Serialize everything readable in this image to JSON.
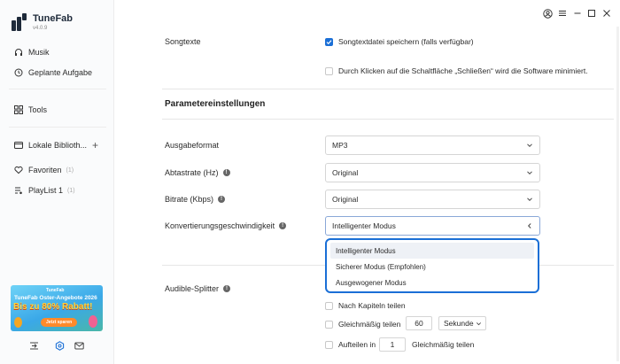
{
  "app": {
    "name": "TuneFab",
    "version": "v4.0.9"
  },
  "sidebar": {
    "items": [
      {
        "label": "Musik",
        "icon": "headphones-icon"
      },
      {
        "label": "Geplante Aufgabe",
        "icon": "clock-icon"
      },
      {
        "label": "Tools",
        "icon": "grid-icon"
      },
      {
        "label": "Lokale Biblioth...",
        "icon": "folder-icon"
      },
      {
        "label": "Favoriten",
        "count": "(1)",
        "icon": "heart-icon"
      },
      {
        "label": "PlayList 1",
        "count": "(1)",
        "icon": "playlist-icon"
      }
    ],
    "add_symbol": "+",
    "promo": {
      "brand": "TuneFab",
      "title": "TuneFab Oster-Angebote 2026",
      "headline": "Bis zu 80% Rabatt!",
      "button": "Jetzt sparen"
    }
  },
  "settings": {
    "songtexte": {
      "label": "Songtexte",
      "save_lyrics": "Songtextdatei speichern (falls verfügbar)",
      "save_lyrics_checked": true,
      "minimize_on_close": "Durch Klicken auf die Schaltfläche „Schließen“ wird die Software minimiert.",
      "minimize_on_close_checked": false
    },
    "section_title": "Parametereinstellungen",
    "output_format": {
      "label": "Ausgabeformat",
      "value": "MP3"
    },
    "sample_rate": {
      "label": "Abtastrate (Hz)",
      "value": "Original"
    },
    "bitrate": {
      "label": "Bitrate (Kbps)",
      "value": "Original"
    },
    "conversion_speed": {
      "label": "Konvertierungsgeschwindigkeit",
      "value": "Intelligenter Modus",
      "options": [
        "Intelligenter Modus",
        "Sicherer Modus (Empfohlen)",
        "Ausgewogener Modus"
      ]
    },
    "audible_splitter": {
      "label": "Audible-Splitter",
      "by_chapter": "Nach Kapiteln teilen",
      "evenly": "Gleichmäßig teilen",
      "evenly_value": "60",
      "evenly_unit": "Sekunde",
      "split_in": "Aufteilen in",
      "split_in_value": "1",
      "split_in_suffix": "Gleichmäßig teilen"
    }
  },
  "colors": {
    "accent": "#1a6fd6",
    "dark": "#1e2a3a"
  }
}
